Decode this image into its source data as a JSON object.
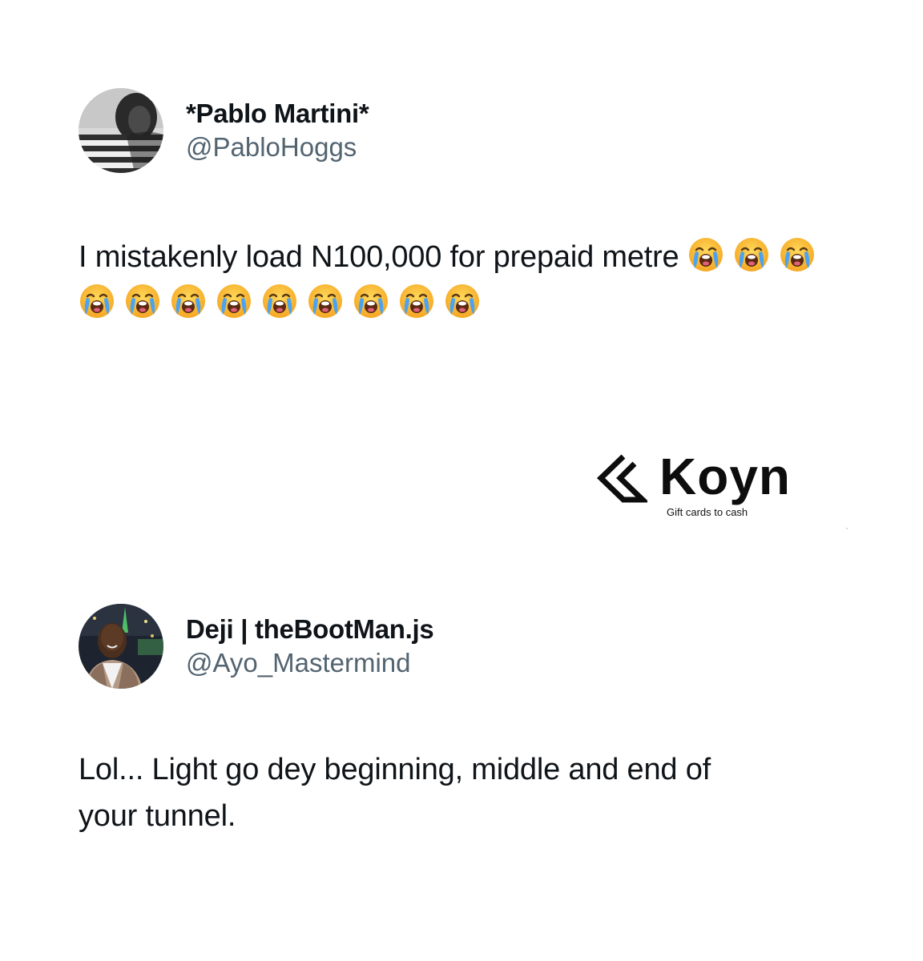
{
  "tweets": [
    {
      "display_name": "*Pablo Martini*",
      "handle": "@PabloHoggs",
      "text": "I mistakenly load N100,000 for prepaid metre",
      "emoji": "loudly-crying-face",
      "emoji_count": 12
    },
    {
      "display_name": "Deji | theBootMan.js",
      "handle": "@Ayo_Mastermind",
      "text_line_1": "Lol... Light go dey beginning, middle and end of",
      "text_line_2": "your tunnel."
    }
  ],
  "brand": {
    "name": "Koyn",
    "tagline": "Gift cards to cash",
    "color": "#0d0d0d"
  },
  "colors": {
    "text": "#0f1419",
    "handle": "#536471",
    "background": "#ffffff"
  }
}
